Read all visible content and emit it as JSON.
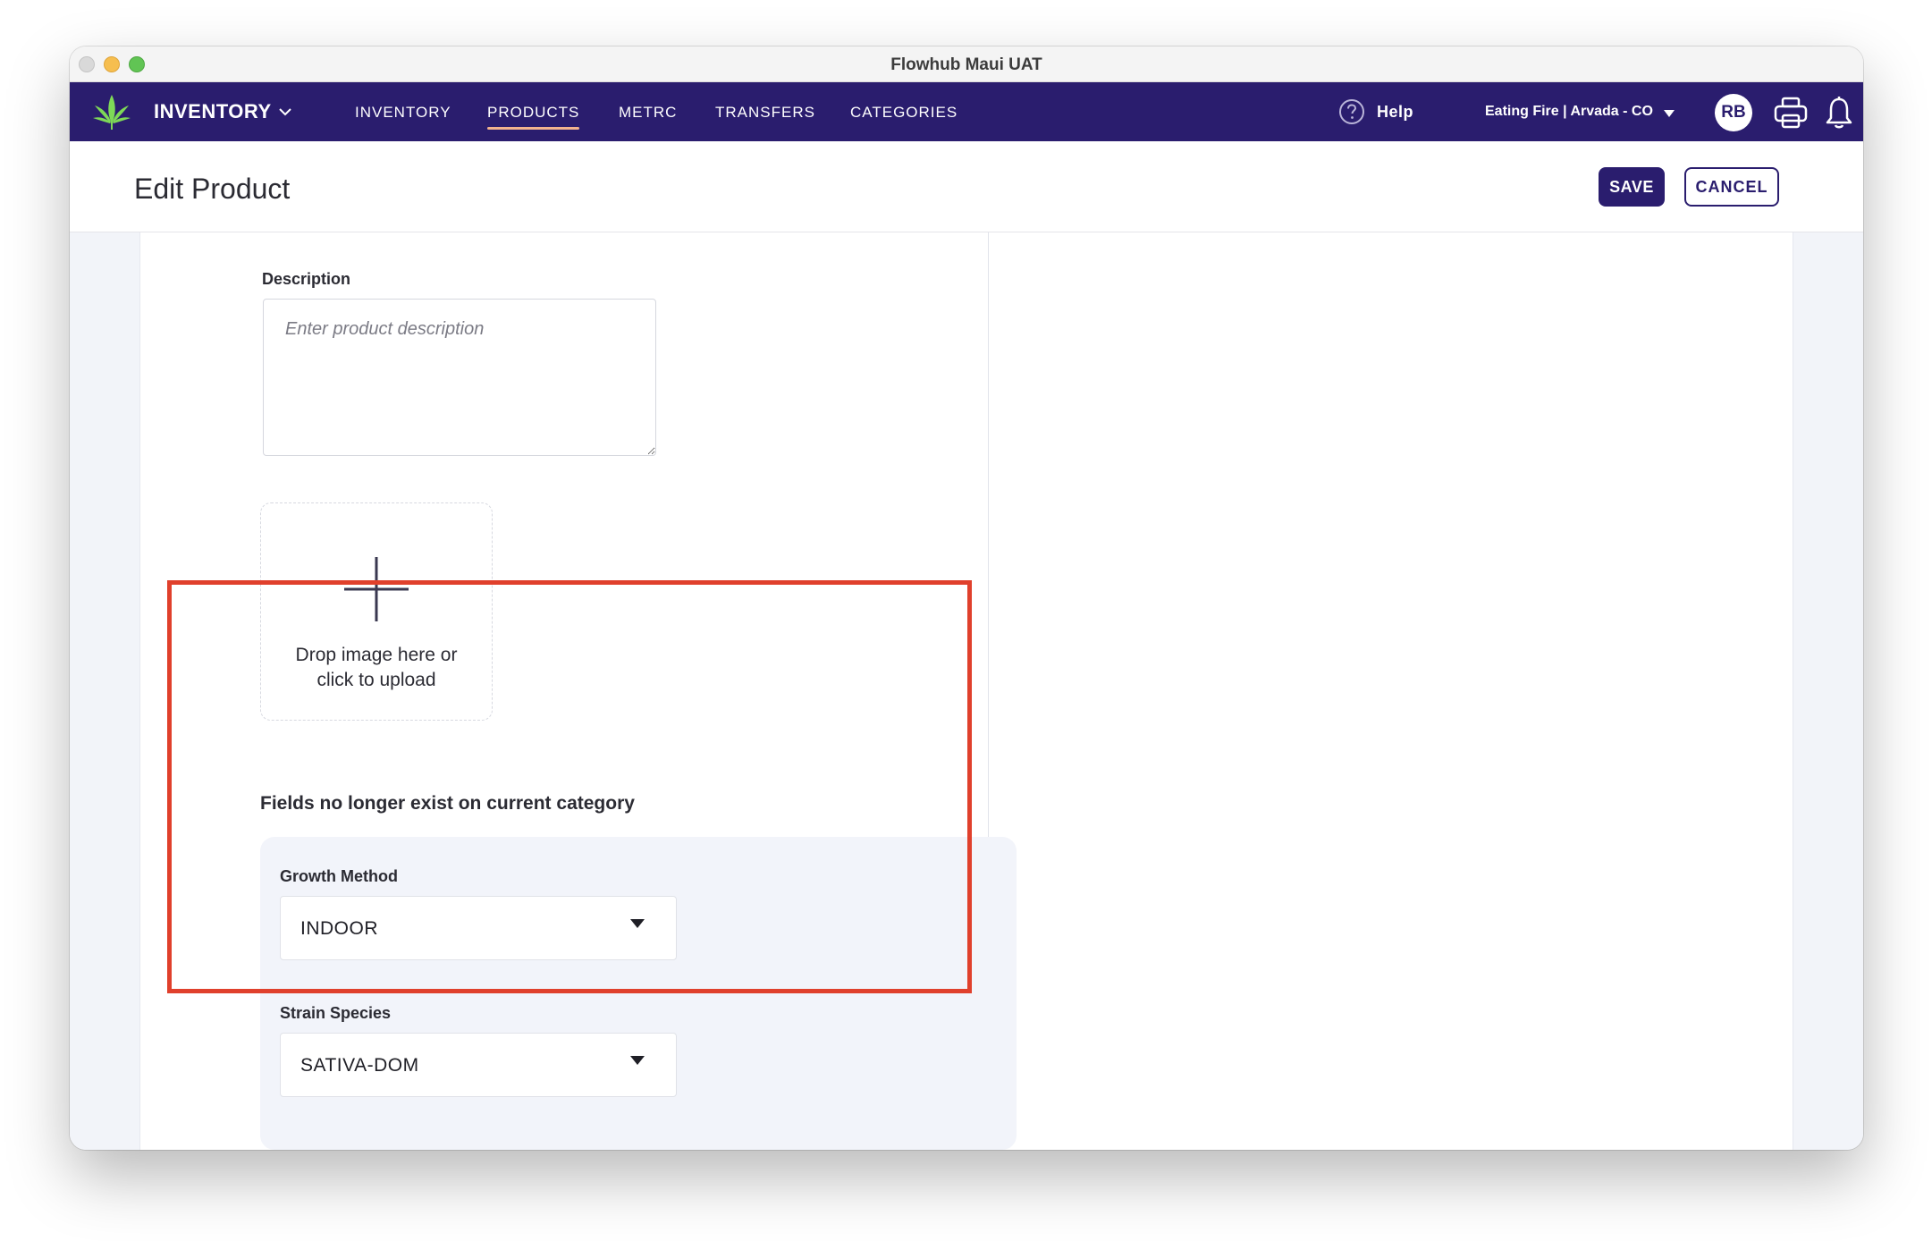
{
  "window": {
    "title": "Flowhub Maui UAT"
  },
  "nav": {
    "brand": "INVENTORY",
    "items": [
      {
        "label": "INVENTORY"
      },
      {
        "label": "PRODUCTS"
      },
      {
        "label": "METRC"
      },
      {
        "label": "TRANSFERS"
      },
      {
        "label": "CATEGORIES"
      }
    ],
    "active_item": "PRODUCTS",
    "help_label": "Help",
    "store": "Eating Fire | Arvada - CO",
    "avatar_initials": "RB",
    "icons": {
      "logo": "cannabis-leaf-icon",
      "help": "question-circle-icon",
      "printer": "printer-icon",
      "notifications": "bell-icon"
    },
    "colors": {
      "background": "#2a1d6e",
      "active_underline": "#f2b38e"
    }
  },
  "header": {
    "title": "Edit Product",
    "save_label": "SAVE",
    "cancel_label": "CANCEL"
  },
  "form": {
    "description": {
      "label": "Description",
      "placeholder": "Enter product description",
      "value": ""
    },
    "image_upload": {
      "text_line1": "Drop image here or",
      "text_line2": "click to upload"
    },
    "legacy_fields": {
      "title": "Fields no longer exist on current category",
      "growth_method": {
        "label": "Growth Method",
        "value": "INDOOR"
      },
      "strain_species": {
        "label": "Strain Species",
        "value": "SATIVA-DOM"
      }
    }
  },
  "annotation": {
    "highlight_color": "#e0402c"
  }
}
